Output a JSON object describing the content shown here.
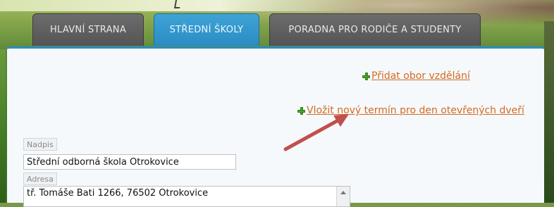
{
  "nav": {
    "tabs": [
      {
        "label": "HLAVNÍ STRANA",
        "active": false
      },
      {
        "label": "STŘEDNÍ ŠKOLY",
        "active": true
      },
      {
        "label": "PORADNA PRO RODIČE A STUDENTY",
        "active": false
      }
    ]
  },
  "actions": {
    "add_field": {
      "label": "Přidat obor vzdělání",
      "icon": "plus-icon"
    },
    "open_day": {
      "label": "Vložit nový termín pro den otevřených dveří",
      "icon": "plus-icon"
    }
  },
  "form": {
    "nadpis": {
      "label": "Nadpis",
      "value": "Střední odborná škola Otrokovice"
    },
    "adresa": {
      "label": "Adresa",
      "value": "tř. Tomáše Bati 1266, 76502 Otrokovice"
    }
  },
  "colors": {
    "active_tab": "#2a8cc4",
    "inactive_tab": "#5e5e5e",
    "link": "#d46a22",
    "plus_icon": "#4aa82a",
    "annotation_arrow": "#c0504d"
  }
}
